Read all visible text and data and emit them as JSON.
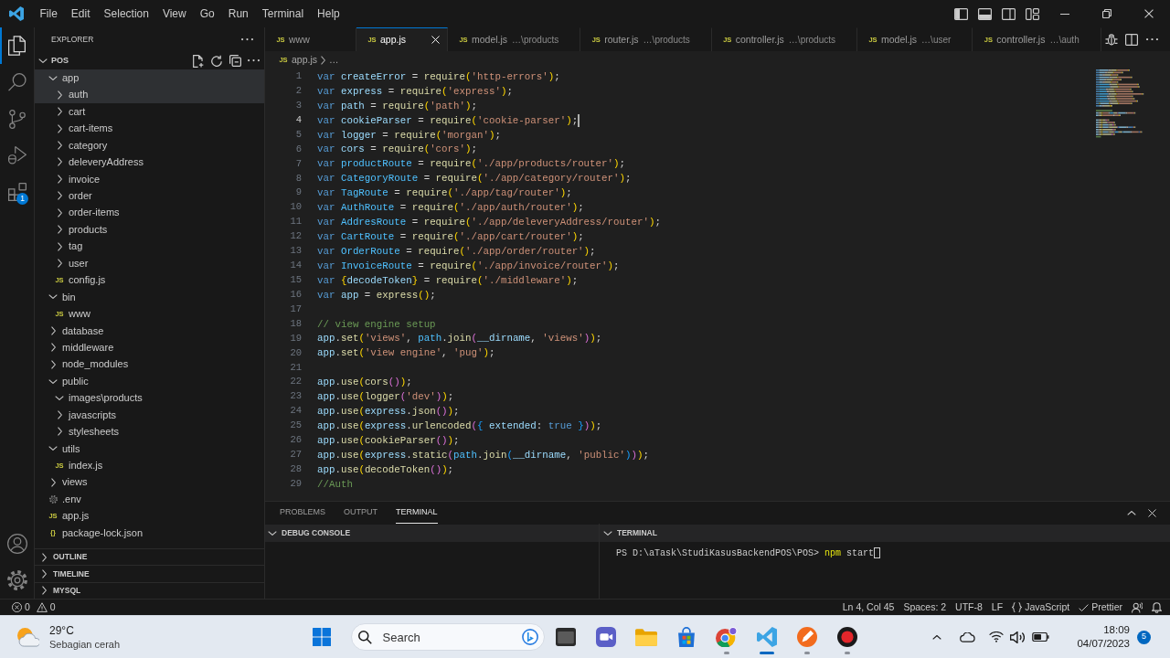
{
  "title_bar": {
    "menu": [
      "File",
      "Edit",
      "Selection",
      "View",
      "Go",
      "Run",
      "Terminal",
      "Help"
    ]
  },
  "activity_bar": {
    "items": [
      {
        "selected": true
      },
      {
        "selected": false
      },
      {
        "selected": false
      },
      {
        "selected": false
      },
      {
        "selected": false,
        "badge": "1"
      }
    ]
  },
  "sidebar": {
    "title": "EXPLORER",
    "root": {
      "label": "POS",
      "expanded": true
    },
    "tree": [
      {
        "label": "app",
        "kind": "folder",
        "expanded": true,
        "selected": true,
        "children": [
          {
            "label": "auth",
            "kind": "folder",
            "expanded": false,
            "selected": true
          },
          {
            "label": "cart",
            "kind": "folder",
            "expanded": false,
            "selected": false
          },
          {
            "label": "cart-items",
            "kind": "folder",
            "expanded": false,
            "selected": false
          },
          {
            "label": "category",
            "kind": "folder",
            "expanded": false,
            "selected": false
          },
          {
            "label": "deleveryAddress",
            "kind": "folder",
            "expanded": false,
            "selected": false
          },
          {
            "label": "invoice",
            "kind": "folder",
            "expanded": false,
            "selected": false
          },
          {
            "label": "order",
            "kind": "folder",
            "expanded": false,
            "selected": false
          },
          {
            "label": "order-items",
            "kind": "folder",
            "expanded": false,
            "selected": false
          },
          {
            "label": "products",
            "kind": "folder",
            "expanded": false,
            "selected": false
          },
          {
            "label": "tag",
            "kind": "folder",
            "expanded": false,
            "selected": false
          },
          {
            "label": "user",
            "kind": "folder",
            "expanded": false,
            "selected": false
          },
          {
            "label": "config.js",
            "kind": "file",
            "icon_text": "JS",
            "selected": false
          }
        ]
      },
      {
        "label": "bin",
        "kind": "folder",
        "expanded": true,
        "selected": false,
        "children": [
          {
            "label": "www",
            "kind": "file",
            "icon_text": "JS",
            "selected": false
          }
        ]
      },
      {
        "label": "database",
        "kind": "folder",
        "expanded": false,
        "selected": false
      },
      {
        "label": "middleware",
        "kind": "folder",
        "expanded": false,
        "selected": false
      },
      {
        "label": "node_modules",
        "kind": "folder",
        "expanded": false,
        "selected": false
      },
      {
        "label": "public",
        "kind": "folder",
        "expanded": true,
        "selected": false,
        "children": [
          {
            "label": "images\\products",
            "kind": "folder",
            "expanded": true,
            "selected": false
          },
          {
            "label": "javascripts",
            "kind": "folder",
            "expanded": false,
            "selected": false
          },
          {
            "label": "stylesheets",
            "kind": "folder",
            "expanded": false,
            "selected": false
          }
        ]
      },
      {
        "label": "utils",
        "kind": "folder",
        "expanded": true,
        "selected": false,
        "children": [
          {
            "label": "index.js",
            "kind": "file",
            "icon_text": "JS",
            "selected": false
          }
        ]
      },
      {
        "label": "views",
        "kind": "folder",
        "expanded": false,
        "selected": false
      },
      {
        "label": ".env",
        "kind": "settings",
        "selected": false
      },
      {
        "label": "app.js",
        "kind": "file",
        "icon_text": "JS",
        "selected": false
      },
      {
        "label": "package-lock.json",
        "kind": "file",
        "icon_text": "{}",
        "selected": false
      }
    ],
    "sections": [
      {
        "label": "OUTLINE",
        "expanded": false
      },
      {
        "label": "TIMELINE",
        "expanded": false
      },
      {
        "label": "MYSQL",
        "expanded": false
      }
    ]
  },
  "editor": {
    "tabs": [
      {
        "label": "www",
        "icon_text": "JS",
        "selected": false
      },
      {
        "label": "app.js",
        "icon_text": "JS",
        "selected": true
      },
      {
        "label": "model.js",
        "description": "…\\products",
        "icon_text": "JS",
        "selected": false
      },
      {
        "label": "router.js",
        "description": "…\\products",
        "icon_text": "JS",
        "selected": false
      },
      {
        "label": "controller.js",
        "description": "…\\products",
        "icon_text": "JS",
        "selected": false
      },
      {
        "label": "model.js",
        "description": "…\\user",
        "icon_text": "JS",
        "selected": false
      },
      {
        "label": "controller.js",
        "description": "…\\auth",
        "icon_text": "JS",
        "selected": false
      }
    ],
    "breadcrumb": [
      {
        "label": "app.js",
        "icon_text": "JS"
      },
      {
        "label": "…"
      }
    ],
    "lines": [
      {
        "number": "1",
        "current": false,
        "tokens": [
          {
            "kind": "keyword",
            "text": "var "
          },
          {
            "kind": "variable",
            "text": "createError"
          },
          {
            "kind": "plain",
            "text": " = "
          },
          {
            "kind": "function",
            "text": "require"
          },
          {
            "kind": "bracket1",
            "text": "("
          },
          {
            "kind": "string",
            "text": "'http-errors'"
          },
          {
            "kind": "bracket1",
            "text": ")"
          },
          {
            "kind": "plain",
            "text": ";"
          }
        ]
      },
      {
        "number": "2",
        "current": false,
        "tokens": [
          {
            "kind": "keyword",
            "text": "var "
          },
          {
            "kind": "variable",
            "text": "express"
          },
          {
            "kind": "plain",
            "text": " = "
          },
          {
            "kind": "function",
            "text": "require"
          },
          {
            "kind": "bracket1",
            "text": "("
          },
          {
            "kind": "string",
            "text": "'express'"
          },
          {
            "kind": "bracket1",
            "text": ")"
          },
          {
            "kind": "plain",
            "text": ";"
          }
        ]
      },
      {
        "number": "3",
        "current": false,
        "tokens": [
          {
            "kind": "keyword",
            "text": "var "
          },
          {
            "kind": "variable",
            "text": "path"
          },
          {
            "kind": "plain",
            "text": " = "
          },
          {
            "kind": "function",
            "text": "require"
          },
          {
            "kind": "bracket1",
            "text": "("
          },
          {
            "kind": "string",
            "text": "'path'"
          },
          {
            "kind": "bracket1",
            "text": ")"
          },
          {
            "kind": "plain",
            "text": ";"
          }
        ]
      },
      {
        "number": "4",
        "current": true,
        "tokens": [
          {
            "kind": "keyword",
            "text": "var "
          },
          {
            "kind": "variable",
            "text": "cookieParser"
          },
          {
            "kind": "plain",
            "text": " = "
          },
          {
            "kind": "function",
            "text": "require"
          },
          {
            "kind": "bracket1",
            "text": "("
          },
          {
            "kind": "string",
            "text": "'cookie-parser'"
          },
          {
            "kind": "bracket1",
            "text": ")"
          },
          {
            "kind": "plain",
            "text": ";"
          }
        ]
      },
      {
        "number": "5",
        "current": false,
        "tokens": [
          {
            "kind": "keyword",
            "text": "var "
          },
          {
            "kind": "variable",
            "text": "logger"
          },
          {
            "kind": "plain",
            "text": " = "
          },
          {
            "kind": "function",
            "text": "require"
          },
          {
            "kind": "bracket1",
            "text": "("
          },
          {
            "kind": "string",
            "text": "'morgan'"
          },
          {
            "kind": "bracket1",
            "text": ")"
          },
          {
            "kind": "plain",
            "text": ";"
          }
        ]
      },
      {
        "number": "6",
        "current": false,
        "tokens": [
          {
            "kind": "keyword",
            "text": "var "
          },
          {
            "kind": "variable",
            "text": "cors"
          },
          {
            "kind": "plain",
            "text": " = "
          },
          {
            "kind": "function",
            "text": "require"
          },
          {
            "kind": "bracket1",
            "text": "("
          },
          {
            "kind": "string",
            "text": "'cors'"
          },
          {
            "kind": "bracket1",
            "text": ")"
          },
          {
            "kind": "plain",
            "text": ";"
          }
        ]
      },
      {
        "number": "7",
        "current": false,
        "tokens": [
          {
            "kind": "keyword",
            "text": "var "
          },
          {
            "kind": "constant",
            "text": "productRoute"
          },
          {
            "kind": "plain",
            "text": " = "
          },
          {
            "kind": "function",
            "text": "require"
          },
          {
            "kind": "bracket1",
            "text": "("
          },
          {
            "kind": "string",
            "text": "'./app/products/router'"
          },
          {
            "kind": "bracket1",
            "text": ")"
          },
          {
            "kind": "plain",
            "text": ";"
          }
        ]
      },
      {
        "number": "8",
        "current": false,
        "tokens": [
          {
            "kind": "keyword",
            "text": "var "
          },
          {
            "kind": "constant",
            "text": "CategoryRoute"
          },
          {
            "kind": "plain",
            "text": " = "
          },
          {
            "kind": "function",
            "text": "require"
          },
          {
            "kind": "bracket1",
            "text": "("
          },
          {
            "kind": "string",
            "text": "'./app/category/router'"
          },
          {
            "kind": "bracket1",
            "text": ")"
          },
          {
            "kind": "plain",
            "text": ";"
          }
        ]
      },
      {
        "number": "9",
        "current": false,
        "tokens": [
          {
            "kind": "keyword",
            "text": "var "
          },
          {
            "kind": "constant",
            "text": "TagRoute"
          },
          {
            "kind": "plain",
            "text": " = "
          },
          {
            "kind": "function",
            "text": "require"
          },
          {
            "kind": "bracket1",
            "text": "("
          },
          {
            "kind": "string",
            "text": "'./app/tag/router'"
          },
          {
            "kind": "bracket1",
            "text": ")"
          },
          {
            "kind": "plain",
            "text": ";"
          }
        ]
      },
      {
        "number": "10",
        "current": false,
        "tokens": [
          {
            "kind": "keyword",
            "text": "var "
          },
          {
            "kind": "constant",
            "text": "AuthRoute"
          },
          {
            "kind": "plain",
            "text": " = "
          },
          {
            "kind": "function",
            "text": "require"
          },
          {
            "kind": "bracket1",
            "text": "("
          },
          {
            "kind": "string",
            "text": "'./app/auth/router'"
          },
          {
            "kind": "bracket1",
            "text": ")"
          },
          {
            "kind": "plain",
            "text": ";"
          }
        ]
      },
      {
        "number": "11",
        "current": false,
        "tokens": [
          {
            "kind": "keyword",
            "text": "var "
          },
          {
            "kind": "constant",
            "text": "AddresRoute"
          },
          {
            "kind": "plain",
            "text": " = "
          },
          {
            "kind": "function",
            "text": "require"
          },
          {
            "kind": "bracket1",
            "text": "("
          },
          {
            "kind": "string",
            "text": "'./app/deleveryAddress/router'"
          },
          {
            "kind": "bracket1",
            "text": ")"
          },
          {
            "kind": "plain",
            "text": ";"
          }
        ]
      },
      {
        "number": "12",
        "current": false,
        "tokens": [
          {
            "kind": "keyword",
            "text": "var "
          },
          {
            "kind": "constant",
            "text": "CartRoute"
          },
          {
            "kind": "plain",
            "text": " = "
          },
          {
            "kind": "function",
            "text": "require"
          },
          {
            "kind": "bracket1",
            "text": "("
          },
          {
            "kind": "string",
            "text": "'./app/cart/router'"
          },
          {
            "kind": "bracket1",
            "text": ")"
          },
          {
            "kind": "plain",
            "text": ";"
          }
        ]
      },
      {
        "number": "13",
        "current": false,
        "tokens": [
          {
            "kind": "keyword",
            "text": "var "
          },
          {
            "kind": "constant",
            "text": "OrderRoute"
          },
          {
            "kind": "plain",
            "text": " = "
          },
          {
            "kind": "function",
            "text": "require"
          },
          {
            "kind": "bracket1",
            "text": "("
          },
          {
            "kind": "string",
            "text": "'./app/order/router'"
          },
          {
            "kind": "bracket1",
            "text": ")"
          },
          {
            "kind": "plain",
            "text": ";"
          }
        ]
      },
      {
        "number": "14",
        "current": false,
        "tokens": [
          {
            "kind": "keyword",
            "text": "var "
          },
          {
            "kind": "constant",
            "text": "InvoiceRoute"
          },
          {
            "kind": "plain",
            "text": " = "
          },
          {
            "kind": "function",
            "text": "require"
          },
          {
            "kind": "bracket1",
            "text": "("
          },
          {
            "kind": "string",
            "text": "'./app/invoice/router'"
          },
          {
            "kind": "bracket1",
            "text": ")"
          },
          {
            "kind": "plain",
            "text": ";"
          }
        ]
      },
      {
        "number": "15",
        "current": false,
        "tokens": [
          {
            "kind": "keyword",
            "text": "var "
          },
          {
            "kind": "bracket1",
            "text": "{"
          },
          {
            "kind": "variable",
            "text": "decodeToken"
          },
          {
            "kind": "bracket1",
            "text": "}"
          },
          {
            "kind": "plain",
            "text": " = "
          },
          {
            "kind": "function",
            "text": "require"
          },
          {
            "kind": "bracket1",
            "text": "("
          },
          {
            "kind": "string",
            "text": "'./middleware'"
          },
          {
            "kind": "bracket1",
            "text": ")"
          },
          {
            "kind": "plain",
            "text": ";"
          }
        ]
      },
      {
        "number": "16",
        "current": false,
        "tokens": [
          {
            "kind": "keyword",
            "text": "var "
          },
          {
            "kind": "variable",
            "text": "app"
          },
          {
            "kind": "plain",
            "text": " = "
          },
          {
            "kind": "function",
            "text": "express"
          },
          {
            "kind": "bracket1",
            "text": "()"
          },
          {
            "kind": "plain",
            "text": ";"
          }
        ]
      },
      {
        "number": "17",
        "current": false
      },
      {
        "number": "18",
        "current": false,
        "tokens": [
          {
            "kind": "comment",
            "text": "// view engine setup"
          }
        ]
      },
      {
        "number": "19",
        "current": false,
        "tokens": [
          {
            "kind": "variable",
            "text": "app"
          },
          {
            "kind": "plain",
            "text": "."
          },
          {
            "kind": "function",
            "text": "set"
          },
          {
            "kind": "bracket1",
            "text": "("
          },
          {
            "kind": "string",
            "text": "'views'"
          },
          {
            "kind": "plain",
            "text": ", "
          },
          {
            "kind": "constant",
            "text": "path"
          },
          {
            "kind": "plain",
            "text": "."
          },
          {
            "kind": "function",
            "text": "join"
          },
          {
            "kind": "bracket2",
            "text": "("
          },
          {
            "kind": "variable",
            "text": "__dirname"
          },
          {
            "kind": "plain",
            "text": ", "
          },
          {
            "kind": "string",
            "text": "'views'"
          },
          {
            "kind": "bracket2",
            "text": ")"
          },
          {
            "kind": "bracket1",
            "text": ")"
          },
          {
            "kind": "plain",
            "text": ";"
          }
        ]
      },
      {
        "number": "20",
        "current": false,
        "tokens": [
          {
            "kind": "variable",
            "text": "app"
          },
          {
            "kind": "plain",
            "text": "."
          },
          {
            "kind": "function",
            "text": "set"
          },
          {
            "kind": "bracket1",
            "text": "("
          },
          {
            "kind": "string",
            "text": "'view engine'"
          },
          {
            "kind": "plain",
            "text": ", "
          },
          {
            "kind": "string",
            "text": "'pug'"
          },
          {
            "kind": "bracket1",
            "text": ")"
          },
          {
            "kind": "plain",
            "text": ";"
          }
        ]
      },
      {
        "number": "21",
        "current": false
      },
      {
        "number": "22",
        "current": false,
        "tokens": [
          {
            "kind": "variable",
            "text": "app"
          },
          {
            "kind": "plain",
            "text": "."
          },
          {
            "kind": "function",
            "text": "use"
          },
          {
            "kind": "bracket1",
            "text": "("
          },
          {
            "kind": "function",
            "text": "cors"
          },
          {
            "kind": "bracket2",
            "text": "()"
          },
          {
            "kind": "bracket1",
            "text": ")"
          },
          {
            "kind": "plain",
            "text": ";"
          }
        ]
      },
      {
        "number": "23",
        "current": false,
        "tokens": [
          {
            "kind": "variable",
            "text": "app"
          },
          {
            "kind": "plain",
            "text": "."
          },
          {
            "kind": "function",
            "text": "use"
          },
          {
            "kind": "bracket1",
            "text": "("
          },
          {
            "kind": "function",
            "text": "logger"
          },
          {
            "kind": "bracket2",
            "text": "("
          },
          {
            "kind": "string",
            "text": "'dev'"
          },
          {
            "kind": "bracket2",
            "text": ")"
          },
          {
            "kind": "bracket1",
            "text": ")"
          },
          {
            "kind": "plain",
            "text": ";"
          }
        ]
      },
      {
        "number": "24",
        "current": false,
        "tokens": [
          {
            "kind": "variable",
            "text": "app"
          },
          {
            "kind": "plain",
            "text": "."
          },
          {
            "kind": "function",
            "text": "use"
          },
          {
            "kind": "bracket1",
            "text": "("
          },
          {
            "kind": "variable",
            "text": "express"
          },
          {
            "kind": "plain",
            "text": "."
          },
          {
            "kind": "function",
            "text": "json"
          },
          {
            "kind": "bracket2",
            "text": "()"
          },
          {
            "kind": "bracket1",
            "text": ")"
          },
          {
            "kind": "plain",
            "text": ";"
          }
        ]
      },
      {
        "number": "25",
        "current": false,
        "tokens": [
          {
            "kind": "variable",
            "text": "app"
          },
          {
            "kind": "plain",
            "text": "."
          },
          {
            "kind": "function",
            "text": "use"
          },
          {
            "kind": "bracket1",
            "text": "("
          },
          {
            "kind": "variable",
            "text": "express"
          },
          {
            "kind": "plain",
            "text": "."
          },
          {
            "kind": "function",
            "text": "urlencoded"
          },
          {
            "kind": "bracket2",
            "text": "("
          },
          {
            "kind": "bracket3",
            "text": "{"
          },
          {
            "kind": "variable",
            "text": " extended"
          },
          {
            "kind": "plain",
            "text": ": "
          },
          {
            "kind": "keyword",
            "text": "true "
          },
          {
            "kind": "bracket3",
            "text": "}"
          },
          {
            "kind": "bracket2",
            "text": ")"
          },
          {
            "kind": "bracket1",
            "text": ")"
          },
          {
            "kind": "plain",
            "text": ";"
          }
        ]
      },
      {
        "number": "26",
        "current": false,
        "tokens": [
          {
            "kind": "variable",
            "text": "app"
          },
          {
            "kind": "plain",
            "text": "."
          },
          {
            "kind": "function",
            "text": "use"
          },
          {
            "kind": "bracket1",
            "text": "("
          },
          {
            "kind": "function",
            "text": "cookieParser"
          },
          {
            "kind": "bracket2",
            "text": "()"
          },
          {
            "kind": "bracket1",
            "text": ")"
          },
          {
            "kind": "plain",
            "text": ";"
          }
        ]
      },
      {
        "number": "27",
        "current": false,
        "tokens": [
          {
            "kind": "variable",
            "text": "app"
          },
          {
            "kind": "plain",
            "text": "."
          },
          {
            "kind": "function",
            "text": "use"
          },
          {
            "kind": "bracket1",
            "text": "("
          },
          {
            "kind": "variable",
            "text": "express"
          },
          {
            "kind": "plain",
            "text": "."
          },
          {
            "kind": "function",
            "text": "static"
          },
          {
            "kind": "bracket2",
            "text": "("
          },
          {
            "kind": "constant",
            "text": "path"
          },
          {
            "kind": "plain",
            "text": "."
          },
          {
            "kind": "function",
            "text": "join"
          },
          {
            "kind": "bracket3",
            "text": "("
          },
          {
            "kind": "variable",
            "text": "__dirname"
          },
          {
            "kind": "plain",
            "text": ", "
          },
          {
            "kind": "string",
            "text": "'public'"
          },
          {
            "kind": "bracket3",
            "text": ")"
          },
          {
            "kind": "bracket2",
            "text": ")"
          },
          {
            "kind": "bracket1",
            "text": ")"
          },
          {
            "kind": "plain",
            "text": ";"
          }
        ]
      },
      {
        "number": "28",
        "current": false,
        "tokens": [
          {
            "kind": "variable",
            "text": "app"
          },
          {
            "kind": "plain",
            "text": "."
          },
          {
            "kind": "function",
            "text": "use"
          },
          {
            "kind": "bracket1",
            "text": "("
          },
          {
            "kind": "function",
            "text": "decodeToken"
          },
          {
            "kind": "bracket2",
            "text": "()"
          },
          {
            "kind": "bracket1",
            "text": ")"
          },
          {
            "kind": "plain",
            "text": ";"
          }
        ]
      },
      {
        "number": "29",
        "current": false,
        "tokens": [
          {
            "kind": "comment",
            "text": "//Auth"
          }
        ]
      }
    ]
  },
  "panel": {
    "tabs": [
      {
        "label": "PROBLEMS",
        "selected": false
      },
      {
        "label": "OUTPUT",
        "selected": false
      },
      {
        "label": "TERMINAL",
        "selected": true
      }
    ],
    "sections": [
      {
        "title": "DEBUG CONSOLE",
        "expanded": true
      },
      {
        "title": "TERMINAL",
        "expanded": true,
        "lines": [
          {
            "cursor": true,
            "tokens": [
              {
                "kind": "prompt",
                "text": "PS D:\\aTask\\StudiKasusBackendPOS\\POS> "
              },
              {
                "kind": "command",
                "text": "npm"
              },
              {
                "kind": "argument",
                "text": " start"
              }
            ]
          }
        ]
      }
    ]
  },
  "status_bar": {
    "errors": "0",
    "warnings": "0",
    "items": [
      {
        "kind": "plain",
        "text": "Ln 4, Col 45"
      },
      {
        "kind": "plain",
        "text": "Spaces: 2"
      },
      {
        "kind": "plain",
        "text": "UTF-8"
      },
      {
        "kind": "plain",
        "text": "LF"
      },
      {
        "kind": "language",
        "text": "JavaScript"
      },
      {
        "kind": "formatter",
        "text": "Prettier"
      }
    ]
  },
  "taskbar": {
    "weather": {
      "temperature": "29°C",
      "condition": "Sebagian cerah"
    },
    "search": {
      "placeholder": "Search"
    },
    "apps": [
      {
        "running": false,
        "active": false
      },
      {
        "running": false,
        "active": false
      },
      {
        "running": false,
        "active": false
      },
      {
        "running": false,
        "active": false
      },
      {
        "running": true,
        "active": false
      },
      {
        "running": true,
        "active": true
      },
      {
        "running": true,
        "active": false
      },
      {
        "running": true,
        "active": false
      }
    ],
    "time": "18:09",
    "date": "04/07/2023",
    "notification_count": "5"
  }
}
